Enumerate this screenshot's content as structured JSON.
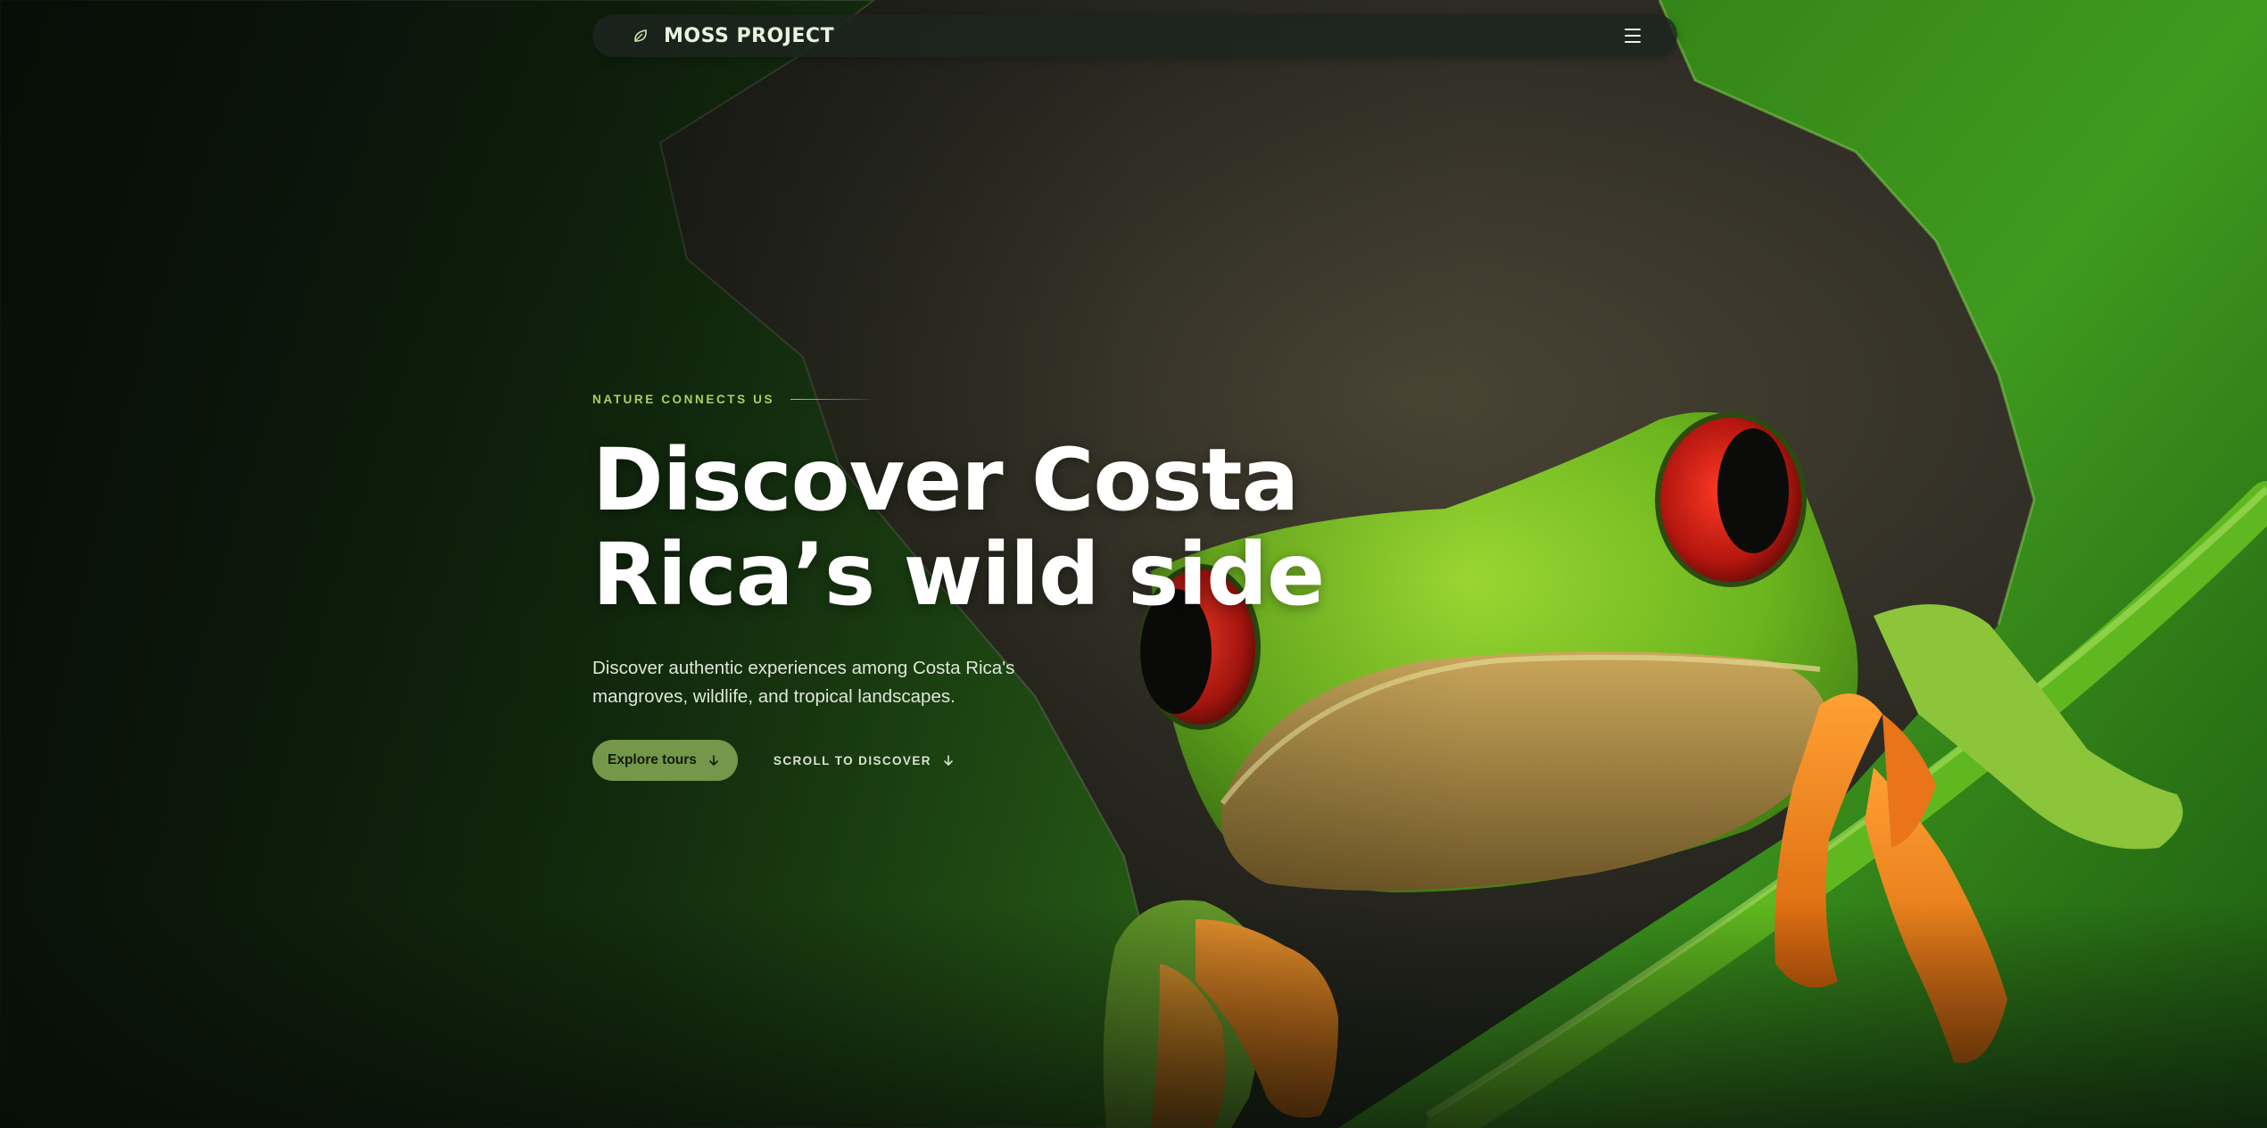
{
  "nav": {
    "brand": "MOSS PROJECT",
    "brand_icon": "leaf-icon",
    "menu_icon": "hamburger-menu-icon"
  },
  "hero": {
    "eyebrow": "NATURE CONNECTS US",
    "headline_line1": "Discover Costa",
    "headline_line2": "Rica’s wild side",
    "description": "Discover authentic experiences among Costa Rica's mangroves, wildlife, and tropical landscapes.",
    "primary_button": "Explore tours",
    "primary_button_icon": "arrow-down-icon",
    "scroll_link": "SCROLL TO DISCOVER",
    "scroll_link_icon": "arrow-down-icon",
    "background_image": "red-eyed-tree-frog-on-leaf"
  },
  "colors": {
    "accent": "#a6d35f",
    "button": "#75974a",
    "nav_bg": "#1c241e",
    "text_light": "#ffffff",
    "leaf_green": "#3a8f1c",
    "frog_green": "#74c21f",
    "frog_eye": "#c8241b",
    "frog_toe": "#f07d14"
  }
}
